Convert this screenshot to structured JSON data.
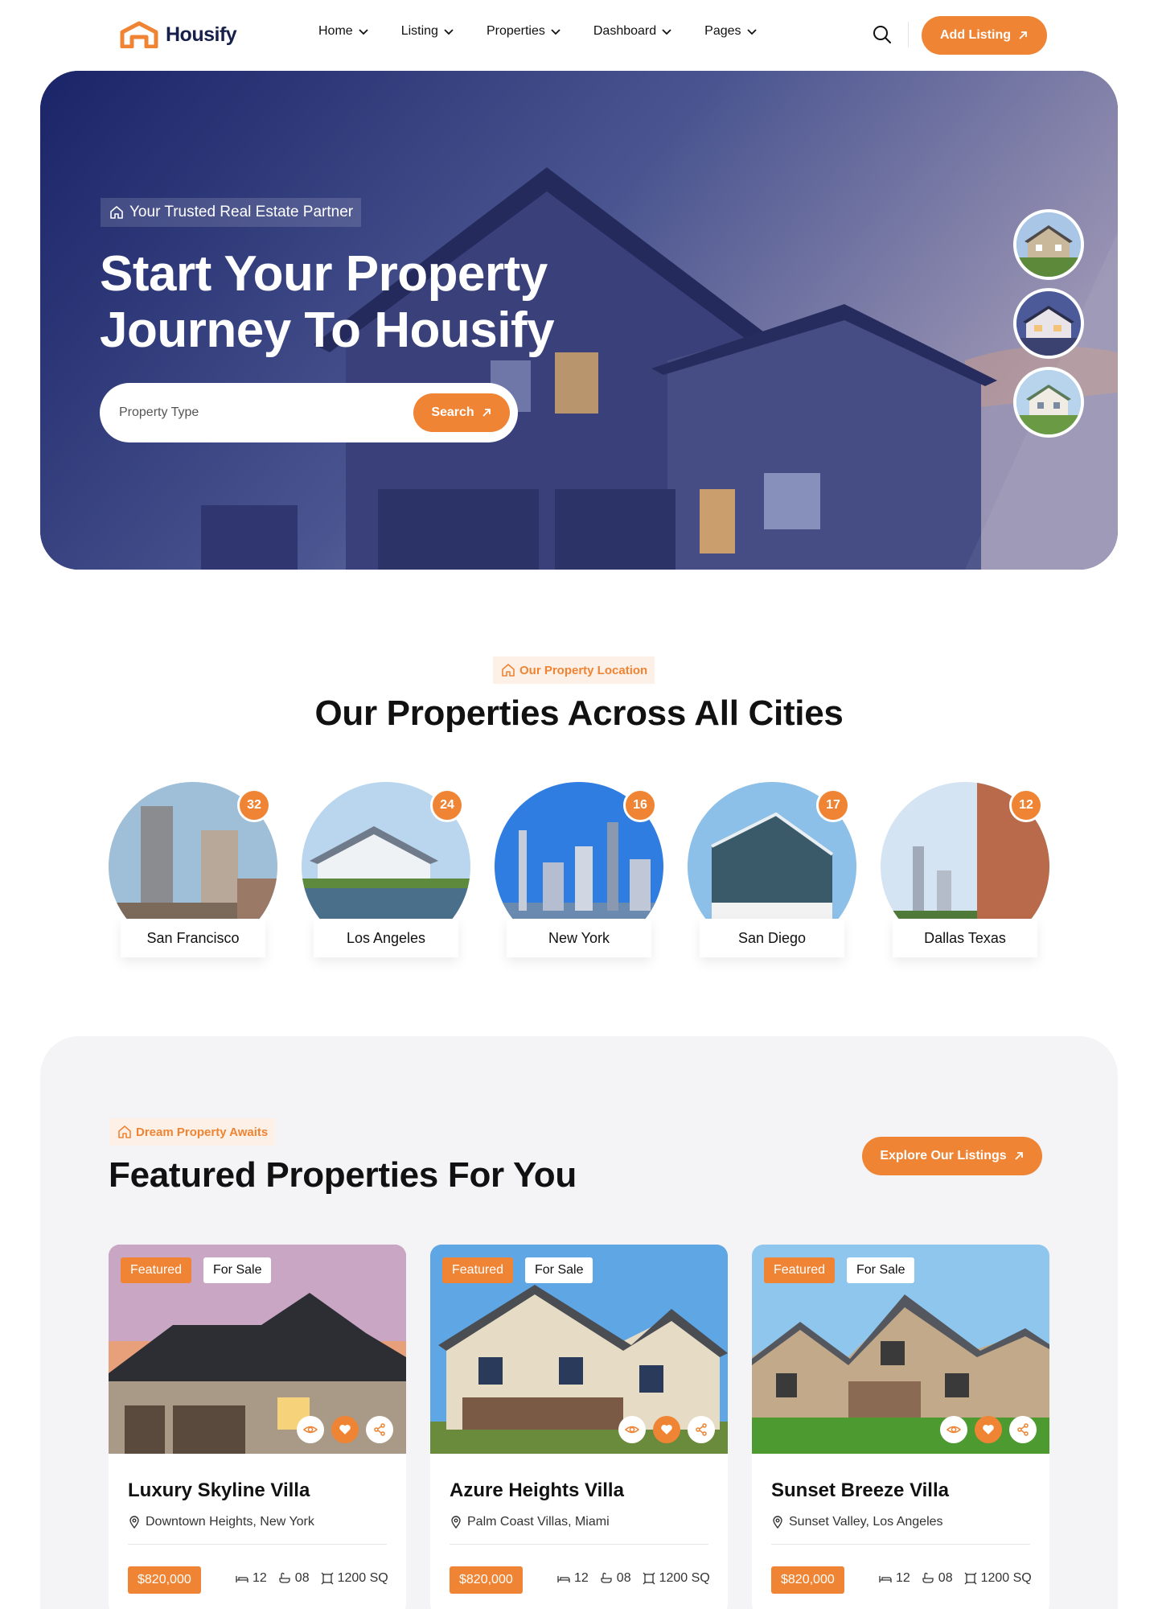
{
  "brand": {
    "name": "Housify",
    "accent": "#ef8434",
    "navy": "#1c2a5e"
  },
  "nav": {
    "menu": [
      {
        "label": "Home"
      },
      {
        "label": "Listing"
      },
      {
        "label": "Properties"
      },
      {
        "label": "Dashboard"
      },
      {
        "label": "Pages"
      }
    ],
    "search_icon": "search-icon",
    "cta_label": "Add Listing"
  },
  "hero": {
    "badge": "Your Trusted Real Estate Partner",
    "title_line1": "Start Your Property",
    "title_line2": "Journey To Housify",
    "search_placeholder": "Property Type",
    "search_button": "Search"
  },
  "locations": {
    "tag": "Our Property Location",
    "title": "Our Properties Across All Cities",
    "cities": [
      {
        "name": "San Francisco",
        "count": "32"
      },
      {
        "name": "Los Angeles",
        "count": "24"
      },
      {
        "name": "New York",
        "count": "16"
      },
      {
        "name": "San Diego",
        "count": "17"
      },
      {
        "name": "Dallas Texas",
        "count": "12"
      }
    ]
  },
  "featured": {
    "tag": "Dream Property Awaits",
    "title": "Featured Properties For You",
    "explore_label": "Explore Our Listings",
    "cards": [
      {
        "featured": "Featured",
        "status": "For Sale",
        "name": "Luxury Skyline Villa",
        "address": "Downtown Heights, New York",
        "price": "$820,000",
        "beds": "12",
        "baths": "08",
        "area": "1200 SQ"
      },
      {
        "featured": "Featured",
        "status": "For Sale",
        "name": "Azure Heights Villa",
        "address": "Palm Coast Villas, Miami",
        "price": "$820,000",
        "beds": "12",
        "baths": "08",
        "area": "1200 SQ"
      },
      {
        "featured": "Featured",
        "status": "For Sale",
        "name": "Sunset Breeze Villa",
        "address": "Sunset Valley, Los Angeles",
        "price": "$820,000",
        "beds": "12",
        "baths": "08",
        "area": "1200 SQ"
      }
    ]
  }
}
